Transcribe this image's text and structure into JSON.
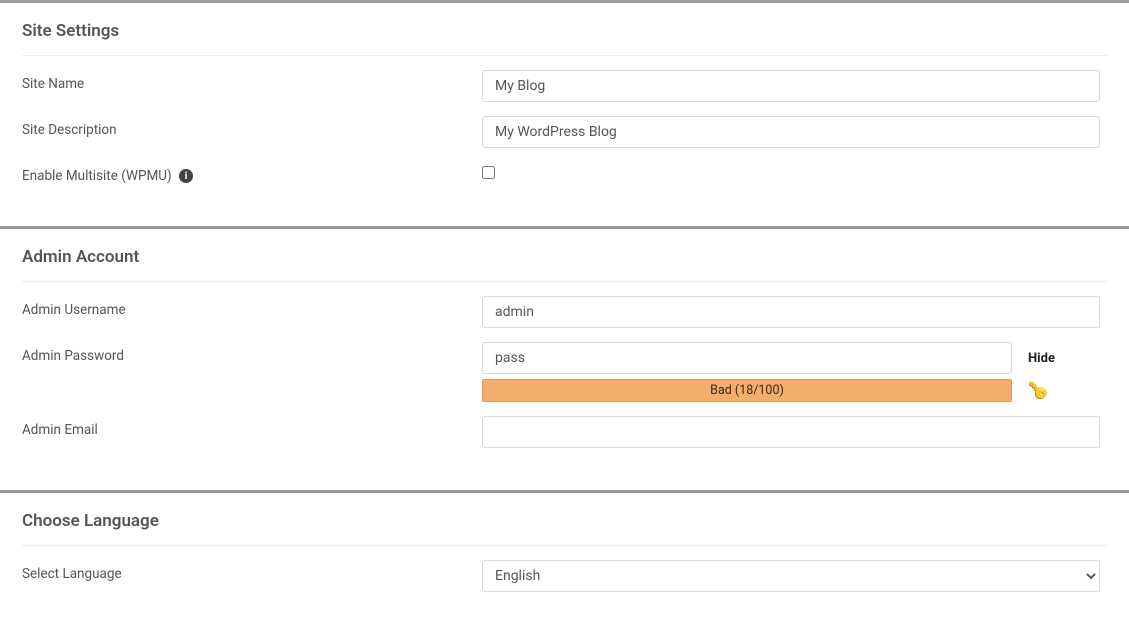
{
  "site": {
    "title": "Site Settings",
    "name_label": "Site Name",
    "name_value": "My Blog",
    "desc_label": "Site Description",
    "desc_value": "My WordPress Blog",
    "multisite_label": "Enable Multisite (WPMU)",
    "multisite_checked": false
  },
  "admin": {
    "title": "Admin Account",
    "username_label": "Admin Username",
    "username_value": "admin",
    "password_label": "Admin Password",
    "password_value": "pass",
    "hide_label": "Hide",
    "strength_text": "Bad (18/100)",
    "email_label": "Admin Email",
    "email_value": ""
  },
  "lang": {
    "title": "Choose Language",
    "select_label": "Select Language",
    "selected": "English"
  }
}
